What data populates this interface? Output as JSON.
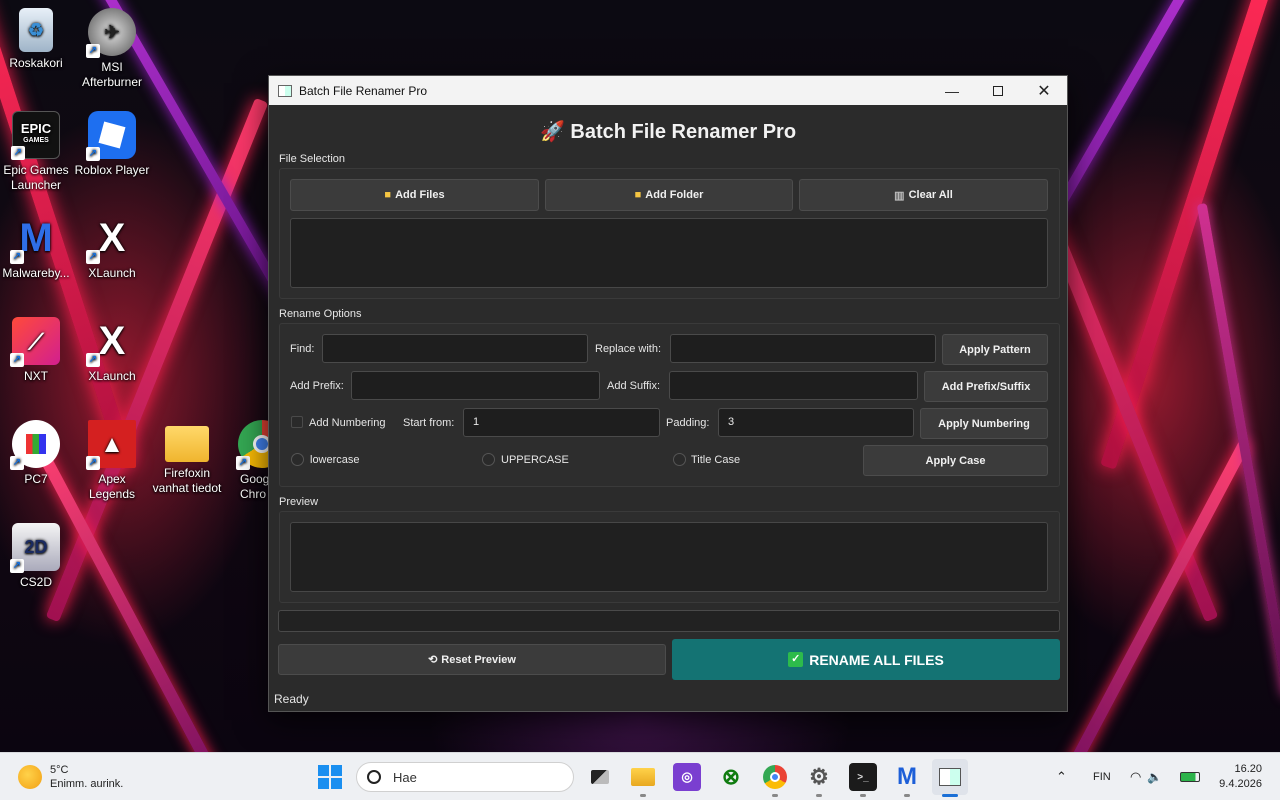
{
  "desktop": {
    "icons": [
      {
        "label": "Roskakori"
      },
      {
        "label": "MSI Afterburner"
      },
      {
        "label": "Epic Games Launcher"
      },
      {
        "label": "Roblox Player"
      },
      {
        "label": "Malwareby..."
      },
      {
        "label": "XLaunch"
      },
      {
        "label": "NXT"
      },
      {
        "label": "XLaunch"
      },
      {
        "label": "PC7"
      },
      {
        "label": "Apex Legends"
      },
      {
        "label": "Firefoxin vanhat tiedot"
      },
      {
        "label": "Goog Chro"
      },
      {
        "label": "CS2D"
      }
    ]
  },
  "window": {
    "title": "Batch File Renamer Pro",
    "app_title": "🚀 Batch File Renamer Pro",
    "file_selection": {
      "label": "File Selection",
      "add_files": "Add Files",
      "add_folder": "Add Folder",
      "clear_all": "Clear All"
    },
    "rename_options": {
      "label": "Rename Options",
      "find_label": "Find:",
      "find_value": "",
      "replace_label": "Replace with:",
      "replace_value": "",
      "apply_pattern": "Apply Pattern",
      "prefix_label": "Add Prefix:",
      "prefix_value": "",
      "suffix_label": "Add Suffix:",
      "suffix_value": "",
      "add_prefix_suffix": "Add Prefix/Suffix",
      "numbering_label": "Add Numbering",
      "numbering_checked": false,
      "start_label": "Start from:",
      "start_value": "1",
      "padding_label": "Padding:",
      "padding_value": "3",
      "apply_numbering": "Apply Numbering",
      "case_lower": "lowercase",
      "case_upper": "UPPERCASE",
      "case_title": "Title Case",
      "apply_case": "Apply Case"
    },
    "preview": {
      "label": "Preview"
    },
    "reset_preview": "Reset Preview",
    "rename_all": "RENAME ALL FILES",
    "status": "Ready"
  },
  "taskbar": {
    "weather_temp": "5°C",
    "weather_desc": "Enimm. aurink.",
    "search_placeholder": "Hae",
    "language": "FIN",
    "time": "16.20",
    "date": "9.4.2026"
  },
  "colors": {
    "window_bg": "#2b2b2b",
    "accent_teal": "#147373",
    "button_bg": "#3b3b3b"
  }
}
